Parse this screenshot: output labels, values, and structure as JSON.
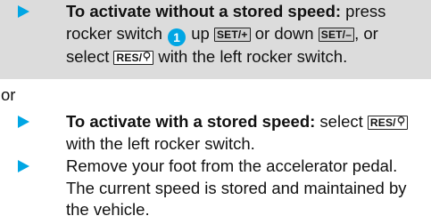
{
  "step1": {
    "heading": "To activate without a stored speed:",
    "t1": " press rocker switch ",
    "badge": "1",
    "t2": " up ",
    "key_up": "SET/+",
    "t3": " or down ",
    "key_down": "SET/–",
    "t4": ", or select ",
    "key_resume_label": "RES/",
    "t5": " with the left rocker switch."
  },
  "or_label": "or",
  "step2": {
    "heading": "To activate with a stored speed:",
    "t1": " select ",
    "key_resume_label": "RES/",
    "t2": " with the left rocker switch."
  },
  "step3": {
    "text": "Remove your foot from the accelerator pedal. The current speed is stored and maintained by the vehicle."
  },
  "icons": {
    "resume_key_glyph": "speedometer-pin-icon",
    "bullet": "triangle-arrow-icon"
  },
  "colors": {
    "accent": "#00a6e4",
    "step_shading": "#dcdcdc"
  }
}
